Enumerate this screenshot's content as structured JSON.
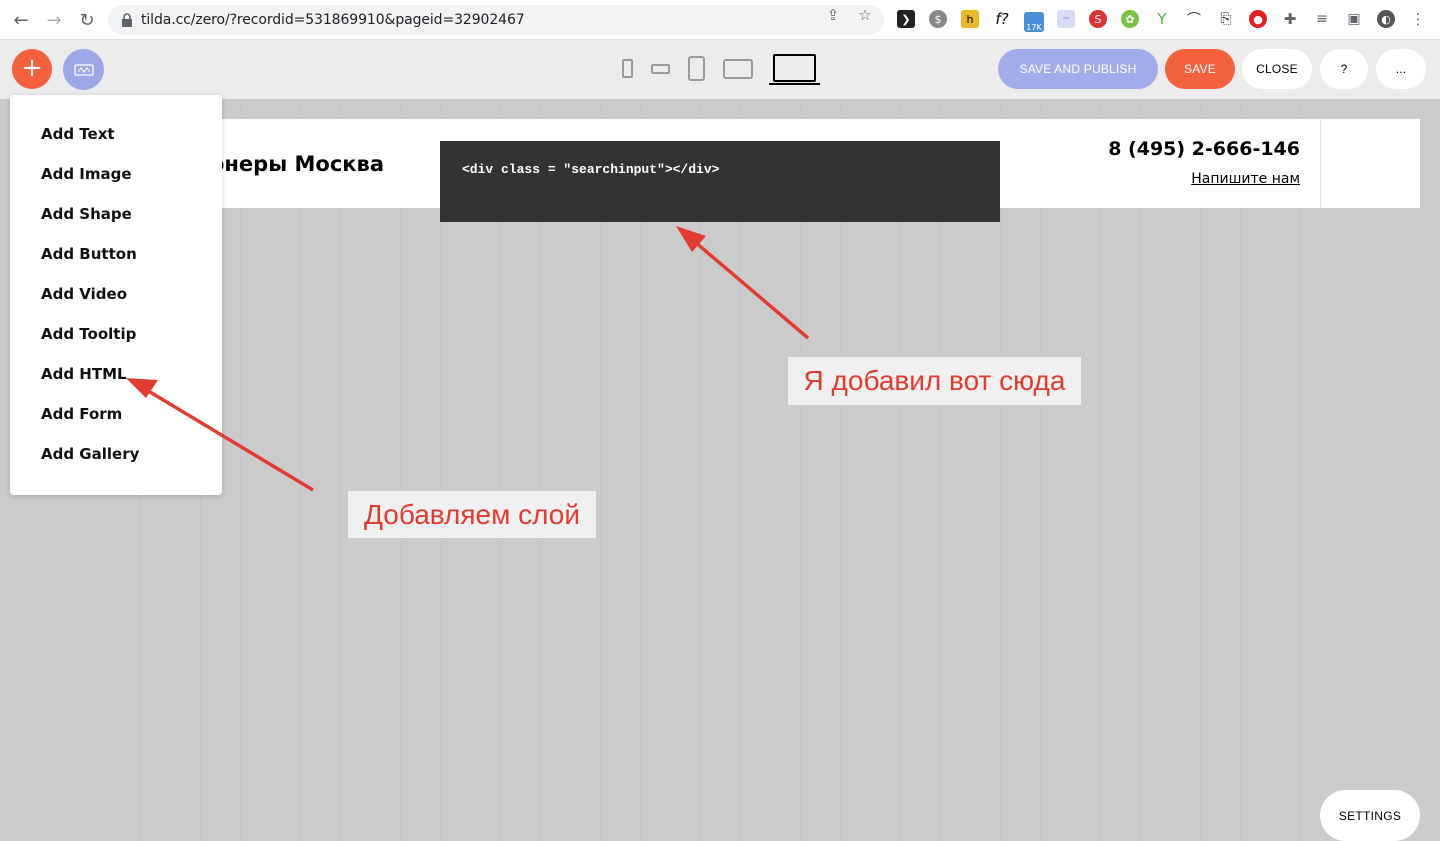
{
  "browser": {
    "url": "tilda.cc/zero/?recordid=531869910&pageid=32902467",
    "extension_badge": "17K"
  },
  "toolbar": {
    "add_label": "+",
    "publish_label": "SAVE AND PUBLISH",
    "save_label": "SAVE",
    "close_label": "CLOSE",
    "help_label": "?",
    "more_label": "...",
    "accent_color": "#f4613f",
    "secondary_color": "#a2acea"
  },
  "canvas": {
    "site_title": "онеры Москва",
    "phone": "8 (495) 2-666-146",
    "contact_link": "Напишите нам",
    "html_code": "<div class = \"searchinput\"></div>"
  },
  "add_menu": {
    "items": [
      {
        "label": "Add Text"
      },
      {
        "label": "Add Image"
      },
      {
        "label": "Add Shape"
      },
      {
        "label": "Add Button"
      },
      {
        "label": "Add Video"
      },
      {
        "label": "Add Tooltip"
      },
      {
        "label": "Add HTML"
      },
      {
        "label": "Add Form"
      },
      {
        "label": "Add Gallery"
      }
    ]
  },
  "annotations": {
    "added_here": "Я добавил вот сюда",
    "add_layer": "Добавляем слой",
    "annotation_color": "#e23b32"
  },
  "settings_label": "SETTINGS"
}
